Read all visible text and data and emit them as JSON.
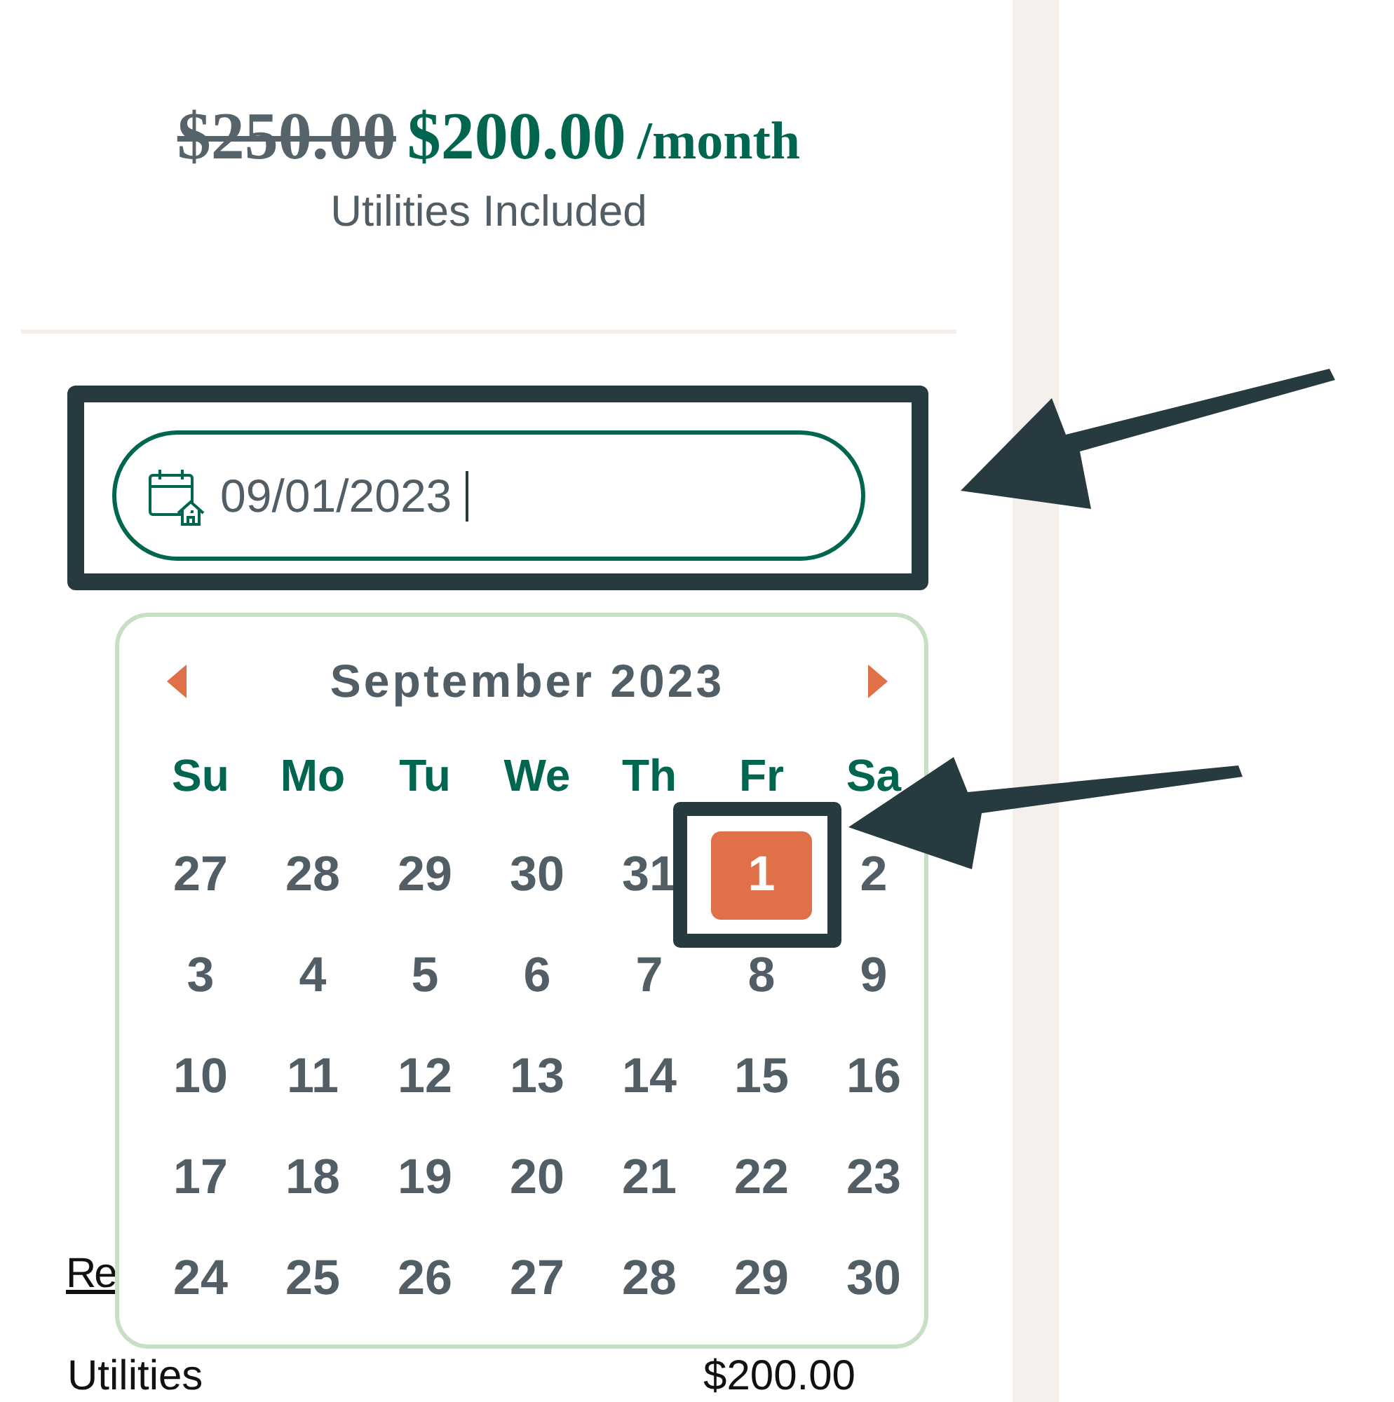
{
  "price": {
    "old": "$250.00",
    "current": "$200.00",
    "period": "/month",
    "note": "Utilities Included"
  },
  "date_field": {
    "value": "09/01/2023"
  },
  "calendar": {
    "title": "September 2023",
    "weekdays": [
      "Su",
      "Mo",
      "Tu",
      "We",
      "Th",
      "Fr",
      "Sa"
    ],
    "weeks": [
      [
        {
          "day": "27",
          "selected": false
        },
        {
          "day": "28",
          "selected": false
        },
        {
          "day": "29",
          "selected": false
        },
        {
          "day": "30",
          "selected": false
        },
        {
          "day": "31",
          "selected": false
        },
        {
          "day": "1",
          "selected": true
        },
        {
          "day": "2",
          "selected": false
        }
      ],
      [
        {
          "day": "3",
          "selected": false
        },
        {
          "day": "4",
          "selected": false
        },
        {
          "day": "5",
          "selected": false
        },
        {
          "day": "6",
          "selected": false
        },
        {
          "day": "7",
          "selected": false
        },
        {
          "day": "8",
          "selected": false
        },
        {
          "day": "9",
          "selected": false
        }
      ],
      [
        {
          "day": "10",
          "selected": false
        },
        {
          "day": "11",
          "selected": false
        },
        {
          "day": "12",
          "selected": false
        },
        {
          "day": "13",
          "selected": false
        },
        {
          "day": "14",
          "selected": false
        },
        {
          "day": "15",
          "selected": false
        },
        {
          "day": "16",
          "selected": false
        }
      ],
      [
        {
          "day": "17",
          "selected": false
        },
        {
          "day": "18",
          "selected": false
        },
        {
          "day": "19",
          "selected": false
        },
        {
          "day": "20",
          "selected": false
        },
        {
          "day": "21",
          "selected": false
        },
        {
          "day": "22",
          "selected": false
        },
        {
          "day": "23",
          "selected": false
        }
      ],
      [
        {
          "day": "24",
          "selected": false
        },
        {
          "day": "25",
          "selected": false
        },
        {
          "day": "26",
          "selected": false
        },
        {
          "day": "27",
          "selected": false
        },
        {
          "day": "28",
          "selected": false
        },
        {
          "day": "29",
          "selected": false
        },
        {
          "day": "30",
          "selected": false
        }
      ]
    ]
  },
  "link": "Re",
  "summary": [
    {
      "label": "Utilities",
      "amount": "$200.00"
    }
  ]
}
